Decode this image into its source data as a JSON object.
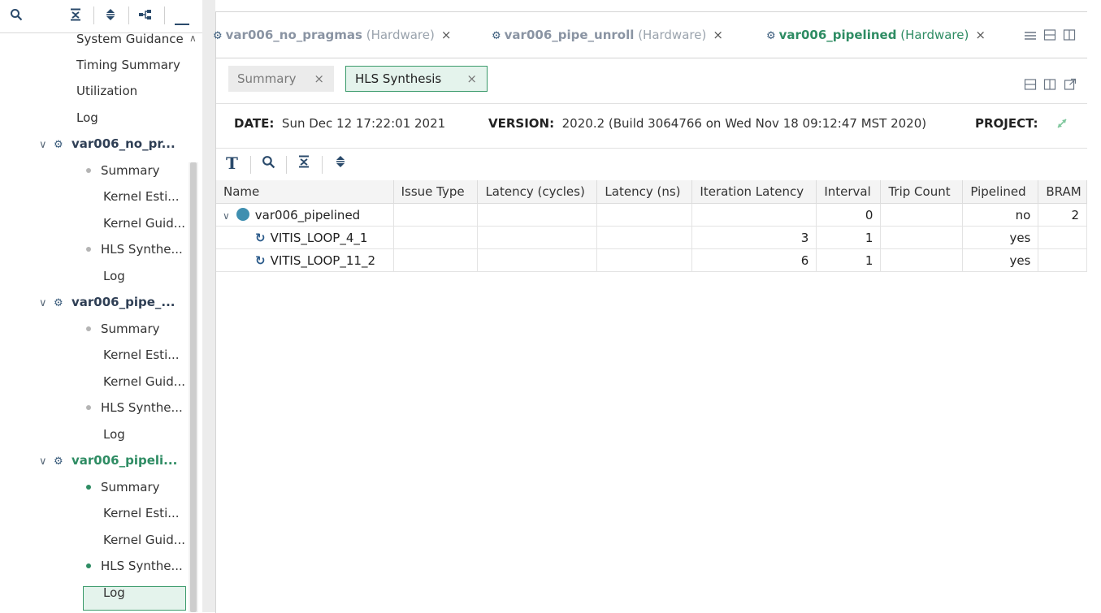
{
  "left_toolbar": {
    "icons": [
      "search-icon",
      "collapse-all-icon",
      "expand-all-icon",
      "hierarchy-icon",
      "minimize-icon"
    ]
  },
  "tree": {
    "top_items": [
      "System Guidance",
      "Timing Summary",
      "Utilization",
      "Log"
    ],
    "projects": [
      {
        "name": "var006_no_pr...",
        "children": [
          {
            "label": "Summary",
            "bullet": true
          },
          {
            "label": "Kernel Esti...",
            "bullet": false
          },
          {
            "label": "Kernel Guid...",
            "bullet": false
          },
          {
            "label": "HLS Synthe...",
            "bullet": true
          },
          {
            "label": "Log",
            "bullet": false
          }
        ]
      },
      {
        "name": "var006_pipe_...",
        "children": [
          {
            "label": "Summary",
            "bullet": true
          },
          {
            "label": "Kernel Esti...",
            "bullet": false
          },
          {
            "label": "Kernel Guid...",
            "bullet": false
          },
          {
            "label": "HLS Synthe...",
            "bullet": true
          },
          {
            "label": "Log",
            "bullet": false
          }
        ]
      },
      {
        "name": "var006_pipeli...",
        "children": [
          {
            "label": "Summary",
            "bullet": true
          },
          {
            "label": "Kernel Esti...",
            "bullet": false
          },
          {
            "label": "Kernel Guid...",
            "bullet": false
          },
          {
            "label": "HLS Synthe...",
            "bullet": true
          },
          {
            "label": "Log",
            "bullet": false
          }
        ]
      }
    ]
  },
  "editor_tabs": [
    {
      "name": "var006_no_pragmas",
      "type": "(Hardware)",
      "close": "×"
    },
    {
      "name": "var006_pipe_unroll",
      "type": "(Hardware)",
      "close": "×"
    },
    {
      "name": "var006_pipelined",
      "type": "(Hardware)",
      "close": "×"
    }
  ],
  "report_tabs": [
    {
      "label": "Summary",
      "close": "×"
    },
    {
      "label": "HLS Synthesis",
      "close": "×"
    }
  ],
  "info": {
    "date_label": "DATE:",
    "date_value": "Sun Dec 12 17:22:01 2021",
    "version_label": "VERSION:",
    "version_value": "2020.2 (Build 3064766 on Wed Nov 18 09:12:47 MST 2020)",
    "project_label": "PROJECT:"
  },
  "table": {
    "columns": [
      "Name",
      "Issue Type",
      "Latency (cycles)",
      "Latency (ns)",
      "Iteration Latency",
      "Interval",
      "Trip Count",
      "Pipelined",
      "BRAM"
    ],
    "rows": [
      {
        "name": "var006_pipelined",
        "issue_type": "",
        "latency_cycles": "",
        "latency_ns": "",
        "iteration_latency": "",
        "interval": "0",
        "trip_count": "",
        "pipelined": "no",
        "bram": "2"
      },
      {
        "name": "VITIS_LOOP_4_1",
        "issue_type": "",
        "latency_cycles": "",
        "latency_ns": "",
        "iteration_latency": "3",
        "interval": "1",
        "trip_count": "",
        "pipelined": "yes",
        "bram": ""
      },
      {
        "name": "VITIS_LOOP_11_2",
        "issue_type": "",
        "latency_cycles": "",
        "latency_ns": "",
        "iteration_latency": "6",
        "interval": "1",
        "trip_count": "",
        "pipelined": "yes",
        "bram": ""
      }
    ]
  },
  "colors": {
    "accent_green": "#2e8c63",
    "selection_bg": "#e4f3ec",
    "dot_blue": "#3f8fb0"
  }
}
